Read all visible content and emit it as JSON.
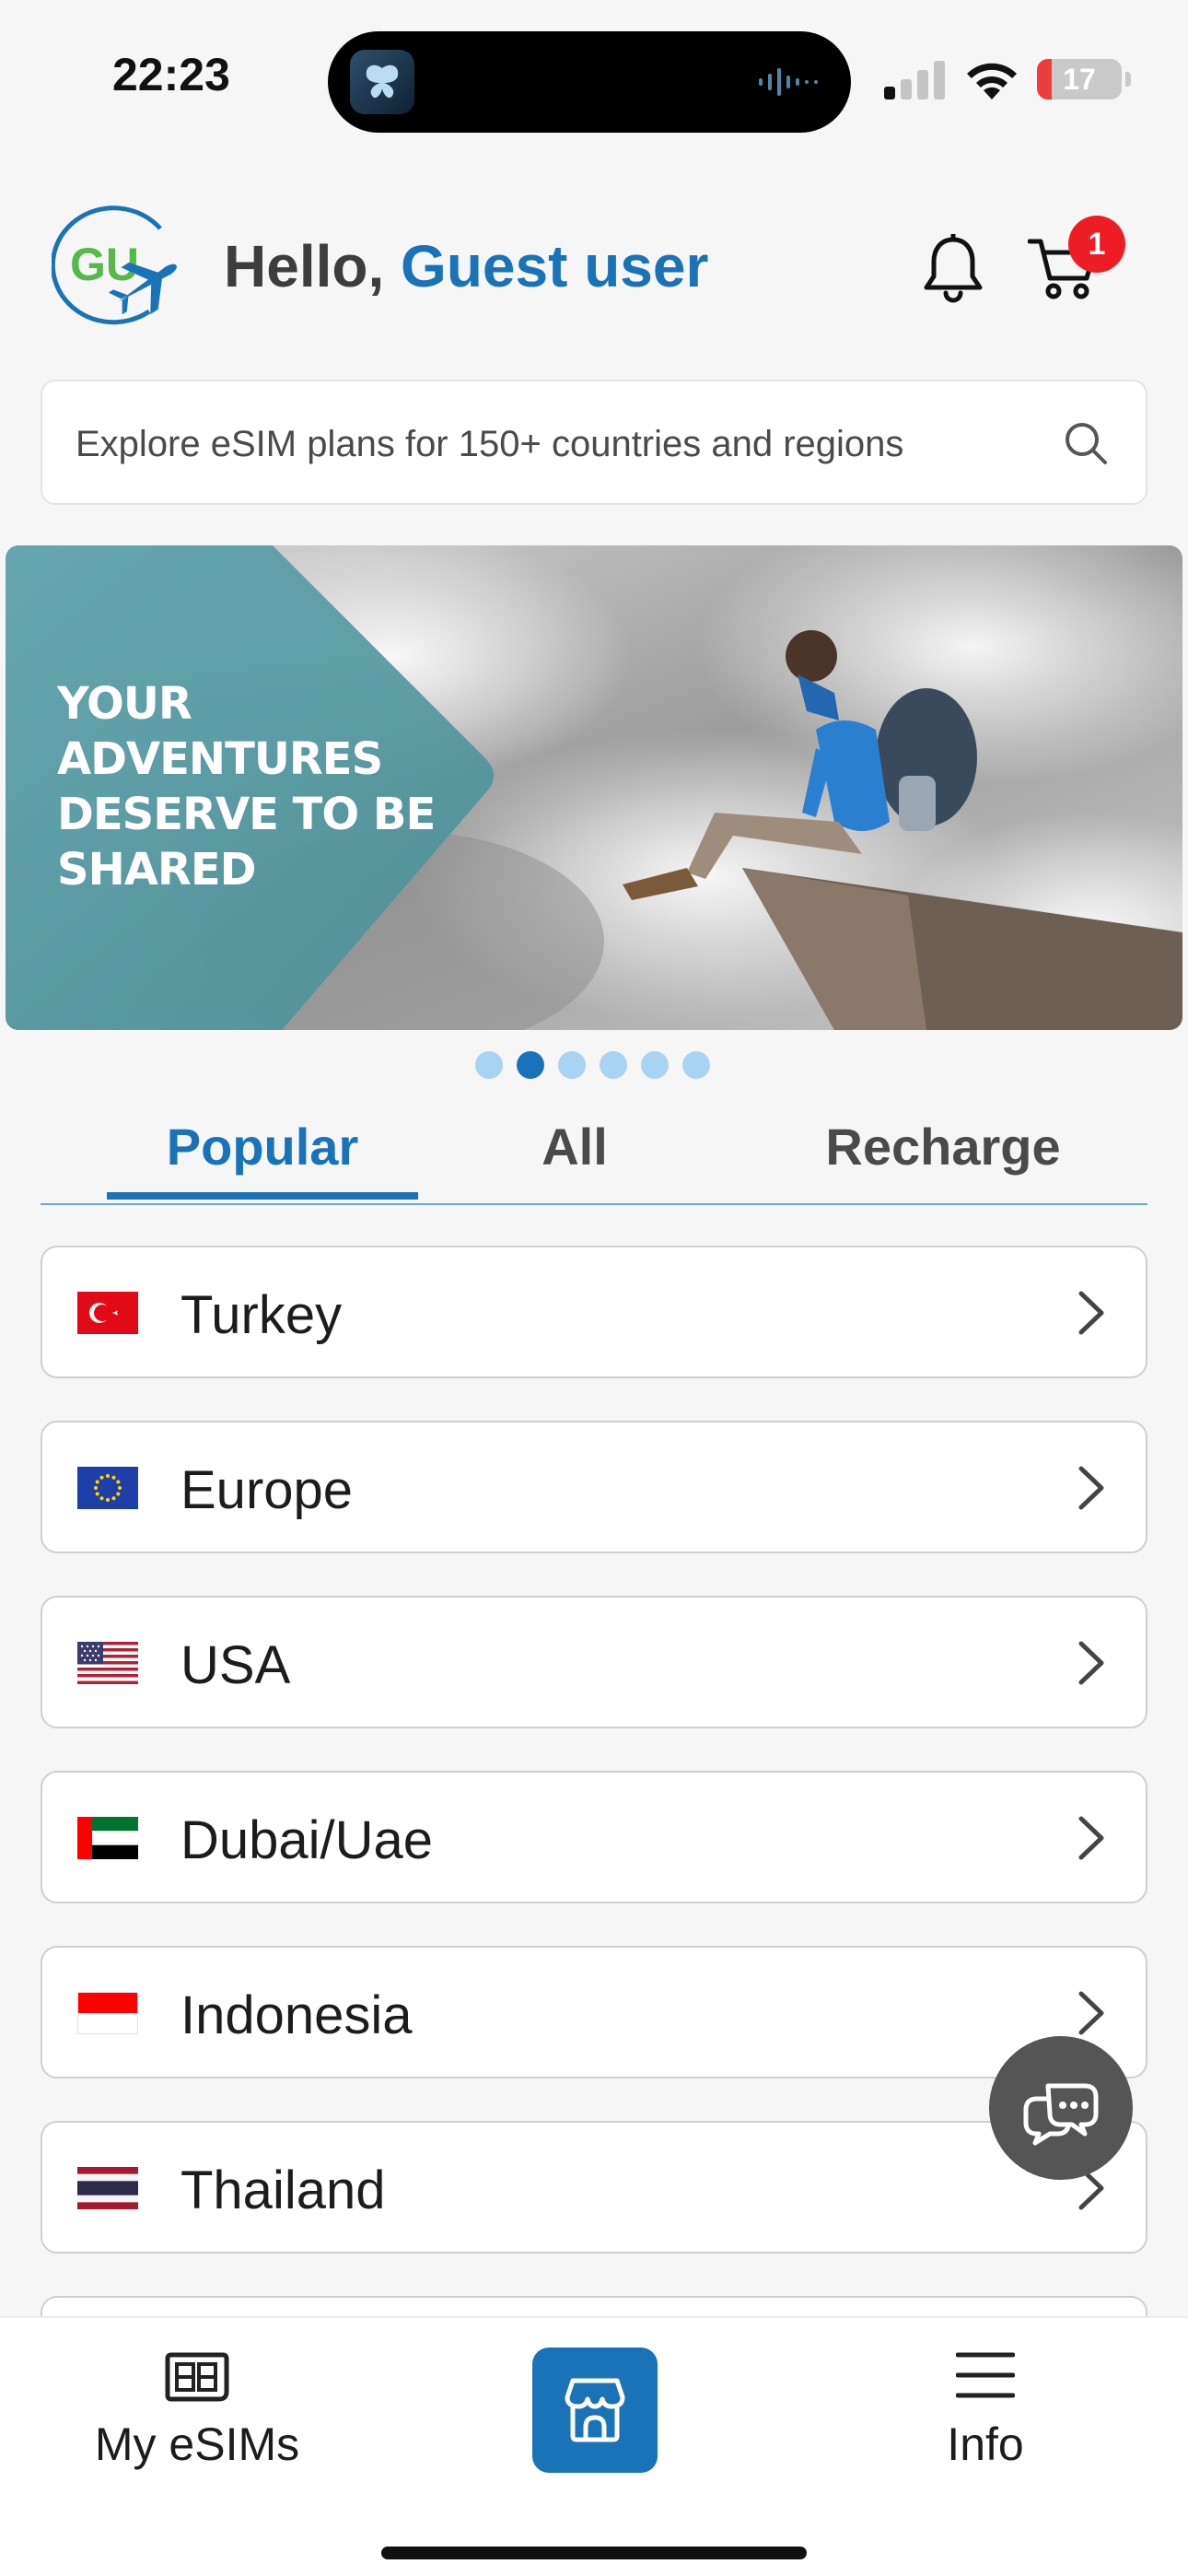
{
  "status_bar": {
    "time": "22:23",
    "battery_percent": "17",
    "battery_level": 0.17
  },
  "header": {
    "greeting_prefix": "Hello, ",
    "user_name": "Guest user",
    "cart_count": "1",
    "logo_text": "GU"
  },
  "search": {
    "placeholder": "Explore eSIM plans for 150+ countries and regions"
  },
  "banner": {
    "headline_lines": [
      "YOUR",
      "ADVENTURES",
      "DESERVE TO BE",
      "SHARED"
    ],
    "slide_count": 6,
    "active_slide": 2
  },
  "tabs": [
    {
      "label": "Popular",
      "active": true
    },
    {
      "label": "All",
      "active": false
    },
    {
      "label": "Recharge",
      "active": false
    }
  ],
  "countries": [
    {
      "name": "Turkey",
      "flag": "turkey-flag-icon"
    },
    {
      "name": "Europe",
      "flag": "eu-flag-icon"
    },
    {
      "name": "USA",
      "flag": "usa-flag-icon"
    },
    {
      "name": "Dubai/Uae",
      "flag": "uae-flag-icon"
    },
    {
      "name": "Indonesia",
      "flag": "indonesia-flag-icon"
    },
    {
      "name": "Thailand",
      "flag": "thailand-flag-icon"
    }
  ],
  "bottom_nav": {
    "my_esims": "My eSIMs",
    "info": "Info"
  },
  "colors": {
    "accent": "#1a73b8",
    "badge": "#ee1c25",
    "chat_fab": "#555555"
  }
}
